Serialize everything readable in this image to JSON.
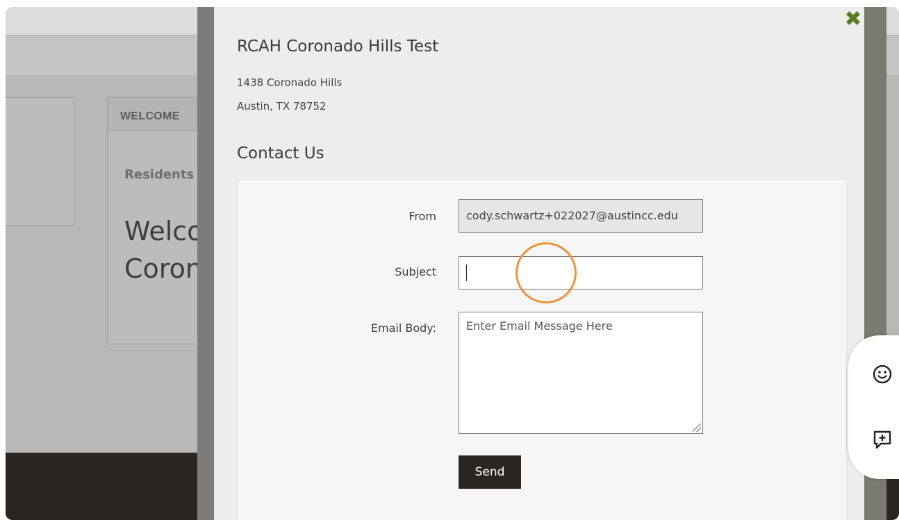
{
  "background": {
    "welcome_header": "WELCOME",
    "residents_label": "Residents",
    "welcome_line1": "Welcome to",
    "welcome_line2": "Coronado"
  },
  "modal": {
    "title": "RCAH Coronado Hills Test",
    "address_line1": "1438 Coronado Hills",
    "address_line2": "Austin, TX 78752",
    "contact_heading": "Contact Us",
    "close_glyph": "✖",
    "form": {
      "from_label": "From",
      "from_value": "cody.schwartz+022027@austincc.edu",
      "subject_label": "Subject",
      "subject_value": "",
      "body_label": "Email Body:",
      "body_placeholder": "Enter Email Message Here",
      "send_label": "Send"
    }
  },
  "side_widget": {
    "icons": [
      "smiley-icon",
      "comment-plus-icon"
    ]
  },
  "colors": {
    "accent": "#2b2522",
    "close": "#5a7a22",
    "click_ring": "#f0913a"
  }
}
